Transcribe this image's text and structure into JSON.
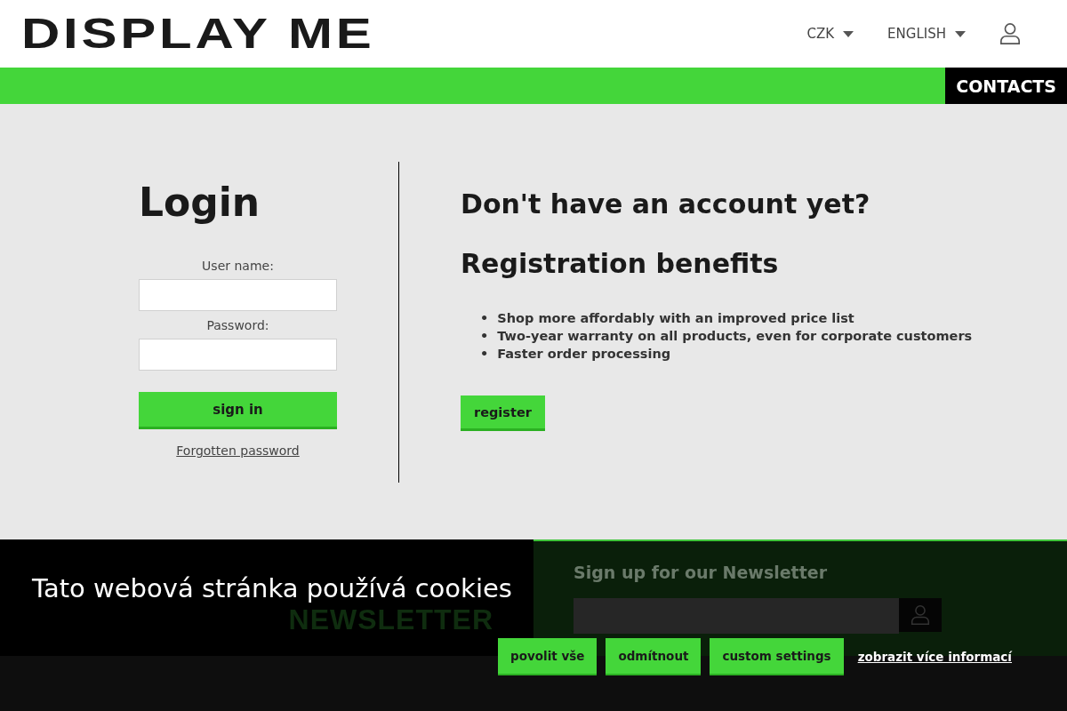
{
  "header": {
    "logo": "DISPLAY ME",
    "currency": "CZK",
    "language": "ENGLISH"
  },
  "navbar": {
    "contacts": "CONTACTS"
  },
  "login": {
    "title": "Login",
    "fields": [
      {
        "label": "User name:"
      },
      {
        "label": "Password:"
      }
    ],
    "submit": "sign in",
    "forgot": "Forgotten password"
  },
  "register": {
    "question": "Don't have an account yet?",
    "benefits_title": "Registration benefits",
    "marker": "•",
    "benefits": [
      "Shop more affordably with an improved price list",
      "Two-year warranty on all products, even for corporate customers",
      "Faster order processing"
    ],
    "button": "register"
  },
  "footer": {
    "newsletter_label": "NEWSLETTER",
    "newsletter_title": "Sign up for our Newsletter"
  },
  "cookie_banner": {
    "message": "Tato webová stránka používá cookies",
    "buttons": [
      "povolit vše",
      "odmítnout",
      "custom settings"
    ],
    "more_link": "zobrazit více informací"
  }
}
